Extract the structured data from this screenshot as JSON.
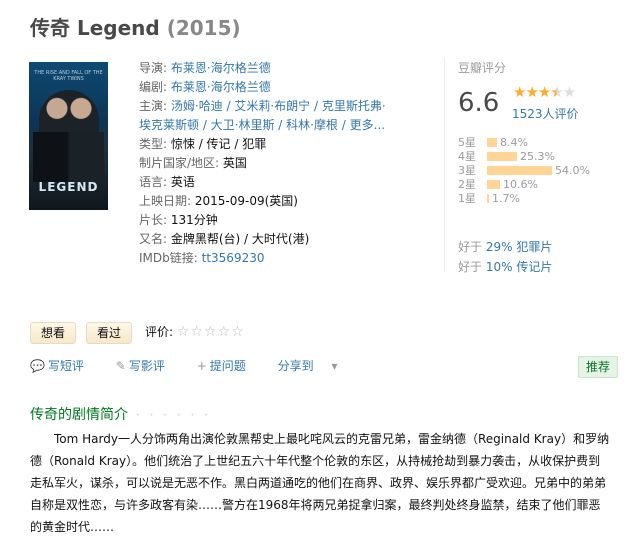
{
  "title": {
    "main": "传奇 Legend",
    "year": "(2015)"
  },
  "poster": {
    "top_text": "THE RISE AND FALL OF THE KRAY TWINS",
    "title_text": "LEGEND"
  },
  "info": {
    "director_label": "导演:",
    "director": "布莱恩·海尔格兰德",
    "writer_label": "编剧:",
    "writer": "布莱恩·海尔格兰德",
    "cast_label": "主演:",
    "cast_line1": "汤姆·哈迪 / 艾米莉·布朗宁 / 克里斯托弗·",
    "cast_line2": "埃克莱斯顿 / 大卫·林里斯 / 科林·摩根 / 更多...",
    "genre_label": "类型:",
    "genre": "惊悚 / 传记 / 犯罪",
    "country_label": "制片国家/地区:",
    "country": "英国",
    "lang_label": "语言:",
    "lang": "英语",
    "release_label": "上映日期:",
    "release": "2015-09-09(英国)",
    "runtime_label": "片长:",
    "runtime": "131分钟",
    "aka_label": "又名:",
    "aka": "金牌黑帮(台) / 大时代(港)",
    "imdb_label": "IMDb链接:",
    "imdb": "tt3569230"
  },
  "rating": {
    "head": "豆瓣评分",
    "score": "6.6",
    "count": "1523人评价",
    "stars_on": "★★★",
    "stars_half": "★",
    "stars_off": "★",
    "distribution": [
      {
        "label": "5星",
        "pct": "8.4%",
        "value": 8.4
      },
      {
        "label": "4星",
        "pct": "25.3%",
        "value": 25.3
      },
      {
        "label": "3星",
        "pct": "54.0%",
        "value": 54.0
      },
      {
        "label": "2星",
        "pct": "10.6%",
        "value": 10.6
      },
      {
        "label": "1星",
        "pct": "1.7%",
        "value": 1.7
      }
    ],
    "better1_prefix": "好于 ",
    "better1_link": "29% 犯罪片",
    "better2_prefix": "好于 ",
    "better2_link": "10% 传记片"
  },
  "buttons": {
    "want": "想看",
    "seen": "看过",
    "rate_label": "评价:",
    "rate_stars": "☆☆☆☆☆"
  },
  "actions": {
    "short": "写短评",
    "review": "写影评",
    "question": "提问题",
    "share": "分享到",
    "recommend": "推荐"
  },
  "summary": {
    "heading": "传奇的剧情简介",
    "dots": "· · · · · ·",
    "text": "Tom Hardy一人分饰两角出演伦敦黑帮史上最叱咤风云的克雷兄弟，雷金纳德（Reginald Kray）和罗纳德（Ronald Kray）。他们统治了上世纪五六十年代整个伦敦的东区，从持械抢劫到暴力袭击，从收保护费到走私军火，谋杀，可以说是无恶不作。黑白两道通吃的他们在商界、政界、娱乐界都广受欢迎。兄弟中的弟弟自称是双性恋，与许多政客有染……警方在1968年将两兄弟捉拿归案，最终判处终身监禁，结束了他们罪恶的黄金时代……"
  }
}
